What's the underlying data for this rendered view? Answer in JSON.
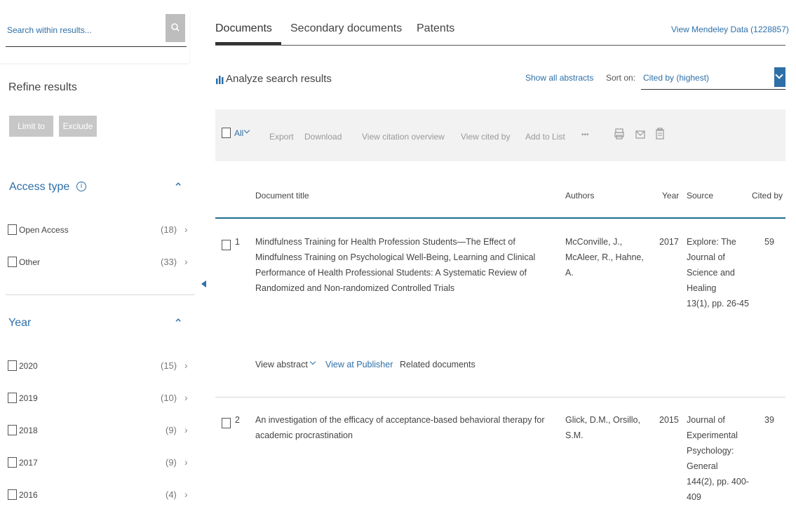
{
  "sidebar": {
    "search_placeholder": "Search within results...",
    "refine_title": "Refine results",
    "limit_button": "Limit to",
    "exclude_button": "Exclude",
    "access_section": {
      "title": "Access type",
      "items": [
        {
          "label": "Open Access",
          "count": "(18)"
        },
        {
          "label": "Other",
          "count": "(33)"
        }
      ]
    },
    "year_section": {
      "title": "Year",
      "items": [
        {
          "label": "2020",
          "count": "(15)"
        },
        {
          "label": "2019",
          "count": "(10)"
        },
        {
          "label": "2018",
          "count": "(9)"
        },
        {
          "label": "2017",
          "count": "(9)"
        },
        {
          "label": "2016",
          "count": "(4)"
        }
      ]
    }
  },
  "tabs": [
    {
      "label": "Documents",
      "active": true
    },
    {
      "label": "Secondary documents",
      "active": false
    },
    {
      "label": "Patents",
      "active": false
    }
  ],
  "mendeley_link": "View Mendeley Data (1228857)",
  "analyze_label": "Analyze search results",
  "show_abstracts": "Show all abstracts",
  "sort_label": "Sort on:",
  "sort_value": "Cited by (highest)",
  "toolbar": {
    "all": "All",
    "export": "Export",
    "download": "Download",
    "citation_overview": "View citation overview",
    "cited_by": "View cited by",
    "add_to_list": "Add to List",
    "more": "•••"
  },
  "columns": {
    "title": "Document title",
    "authors": "Authors",
    "year": "Year",
    "source": "Source",
    "cited": "Cited by"
  },
  "results": [
    {
      "num": "1",
      "title_lines": [
        "Mindfulness Training for Health Profession Students—The Effect of",
        "Mindfulness Training on Psychological Well-Being, Learning and Clinical",
        "Performance of Health Professional Students: A Systematic Review of",
        "Randomized and Non-randomized Controlled Trials"
      ],
      "author_lines": [
        "McConville, J.,",
        "McAleer, R., Hahne,",
        "A."
      ],
      "year": "2017",
      "source_lines": [
        "Explore: The",
        "Journal of",
        "Science and",
        "Healing",
        "13(1), pp. 26-45"
      ],
      "cited": "59",
      "actions": {
        "abstract": "View abstract",
        "publisher": "View at Publisher",
        "related": "Related documents"
      }
    },
    {
      "num": "2",
      "title_lines": [
        "An investigation of the efficacy of acceptance-based behavioral therapy for",
        "academic procrastination"
      ],
      "author_lines": [
        "Glick, D.M., Orsillo,",
        "S.M."
      ],
      "year": "2015",
      "source_lines": [
        "Journal of",
        "Experimental",
        "Psychology:",
        "General",
        "144(2), pp. 400-",
        "409"
      ],
      "cited": "39"
    }
  ],
  "colors": {
    "link": "#2e6fa8",
    "accent": "#1f6e8c",
    "button_gray": "#c7c7c7",
    "toolbar_bg": "#f2f2f2"
  }
}
